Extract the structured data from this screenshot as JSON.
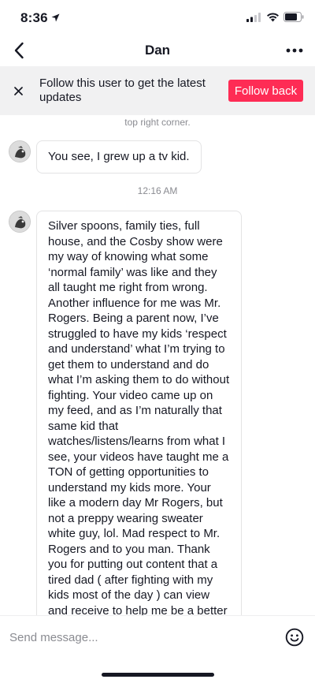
{
  "status_bar": {
    "time": "8:36",
    "icons": [
      "location-arrow-icon",
      "signal-icon",
      "wifi-icon",
      "battery-icon"
    ]
  },
  "nav": {
    "title": "Dan",
    "back_icon": "chevron-left-icon",
    "more_icon": "more-dots-icon"
  },
  "follow_banner": {
    "text": "Follow this user to get the latest updates",
    "button_label": "Follow back",
    "close_icon": "close-icon",
    "button_color": "#fe2c55"
  },
  "chat": {
    "partial_message": "top right corner.",
    "messages": [
      {
        "text": "You see, I grew up a tv kid."
      },
      {
        "text": "Silver spoons, family ties, full house, and the Cosby show were my way of knowing what some ‘normal family’ was like and they all taught me right from wrong. Another influence for me was Mr. Rogers. Being a parent now, I’ve struggled to have my kids ‘respect and understand’ what I’m trying to get them to understand and do what I’m asking them to do without fighting. Your video came up on my feed, and as I’m naturally that same kid that watches/listens/learns from what I see, your videos have taught me a TON of getting opportunities to understand my kids more. Your like a modern day Mr Rogers, but not a preppy wearing sweater white guy, lol. Mad respect to Mr. Rogers and to you man. Thank you for putting out content that a tired dad ( after fighting with my kids most of the day ) can view and receive to help me be a better day tomorrow. Peace!"
      }
    ],
    "timestamp": "12:16 AM"
  },
  "input": {
    "placeholder": "Send message...",
    "emoji_icon": "emoji-smile-icon"
  }
}
